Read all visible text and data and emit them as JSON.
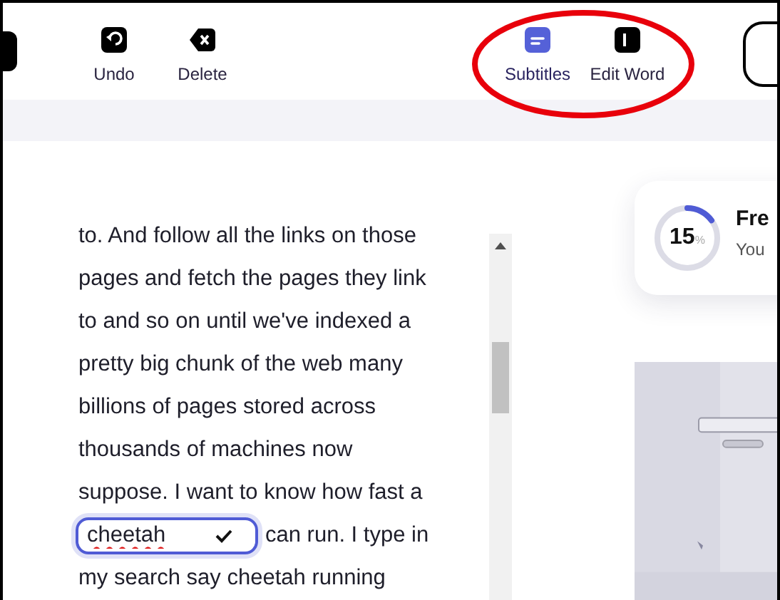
{
  "toolbar": {
    "tools": [
      {
        "label": "Undo",
        "kind": "undo",
        "selected": false
      },
      {
        "label": "Delete",
        "kind": "delete",
        "selected": false
      },
      {
        "label": "Subtitles",
        "kind": "subtitles",
        "selected": true
      },
      {
        "label": "Edit Word",
        "kind": "edit",
        "selected": false
      }
    ]
  },
  "transcript": {
    "lines": [
      {
        "kind": "text",
        "text": "to. And follow all the links on those"
      },
      {
        "kind": "text",
        "text": "pages and fetch the pages they link"
      },
      {
        "kind": "text",
        "text": "to and so on until we've indexed a"
      },
      {
        "kind": "text",
        "text": "pretty big chunk of the web many"
      },
      {
        "kind": "text",
        "text": "billions of pages stored across"
      },
      {
        "kind": "text",
        "text": "thousands of machines now"
      },
      {
        "kind": "text",
        "text": "suppose. I want to know how fast a"
      },
      {
        "kind": "field",
        "value": "cheetah",
        "text": "can run. I type in"
      },
      {
        "kind": "text",
        "text": "my search say cheetah running"
      }
    ]
  },
  "progress_card": {
    "level": 0.15,
    "number": "15",
    "unit": "%",
    "title": "Fre",
    "subtitle": "You"
  },
  "annotation": {
    "kind": "ellipse"
  }
}
